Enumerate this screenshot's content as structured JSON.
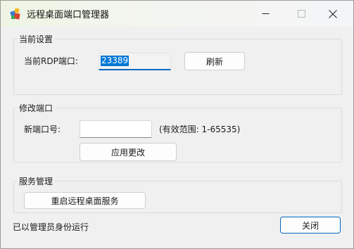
{
  "window": {
    "title": "远程桌面端口管理器"
  },
  "current_settings": {
    "group_label": "当前设置",
    "port_label": "当前RDP端口:",
    "port_value": "23389",
    "refresh_label": "刷新"
  },
  "modify_port": {
    "group_label": "修改端口",
    "new_port_label": "新端口号:",
    "new_port_value": "",
    "range_hint": "(有效范围: 1-65535)",
    "apply_label": "应用更改"
  },
  "service": {
    "group_label": "服务管理",
    "restart_label": "重启远程桌面服务"
  },
  "footer": {
    "status": "已以管理员身份运行",
    "close_label": "关闭"
  },
  "colors": {
    "accent": "#0067c0",
    "selection": "#0078d7"
  },
  "icons": {
    "app": "app-icon",
    "minimize": "minimize-icon",
    "maximize": "maximize-icon",
    "close": "close-icon"
  }
}
